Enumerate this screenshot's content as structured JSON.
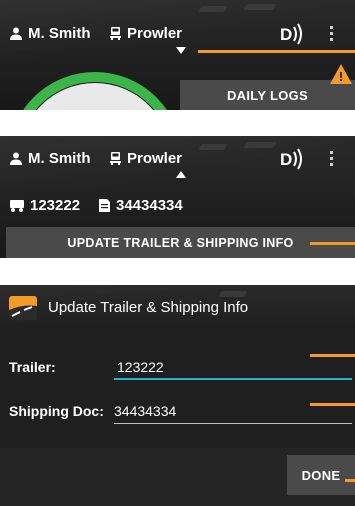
{
  "panel1": {
    "driver_name": "M. Smith",
    "vehicle_name": "Prowler",
    "daily_logs_label": "DAILY LOGS",
    "alert_glyph": "!",
    "icons": [
      "person-icon",
      "truck-icon",
      "signal-icon",
      "more-vert-icon",
      "caret-down-icon",
      "warning-icon"
    ]
  },
  "panel2": {
    "driver_name": "M. Smith",
    "vehicle_name": "Prowler",
    "trailer_number": "123222",
    "shipping_doc_number": "34434334",
    "update_button_label": "UPDATE TRAILER & SHIPPING INFO",
    "icons": [
      "person-icon",
      "truck-icon",
      "signal-icon",
      "more-vert-icon",
      "caret-up-icon",
      "trailer-icon",
      "document-icon"
    ]
  },
  "dialog": {
    "title": "Update Trailer & Shipping Info",
    "trailer_label": "Trailer:",
    "trailer_value": "123222",
    "shipping_doc_label": "Shipping Doc:",
    "shipping_doc_value": "34434334",
    "done_label": "DONE",
    "icons": [
      "road-logo-icon"
    ]
  },
  "colors": {
    "accent": "#f39a2b",
    "focus_underline": "#1fb8d3",
    "status_green": "#3bb54a",
    "warning": "#f39a2b",
    "button_bg": "#4a4a4a",
    "header_bg": "#1f1f1f"
  }
}
